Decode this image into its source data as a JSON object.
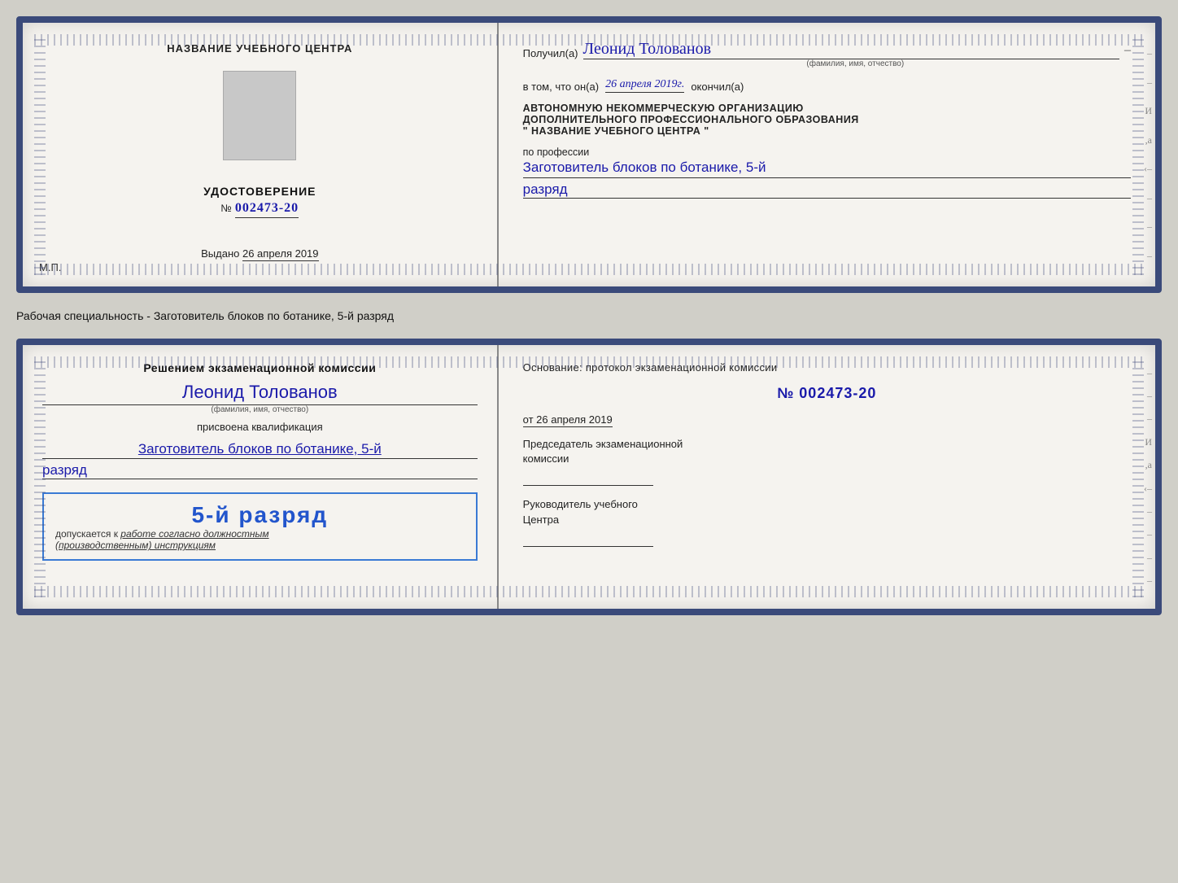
{
  "card1": {
    "left": {
      "title": "НАЗВАНИЕ УЧЕБНОГО ЦЕНТРА",
      "udostoverenie_label": "УДОСТОВЕРЕНИЕ",
      "number_prefix": "№",
      "number": "002473-20",
      "vydano_label": "Выдано",
      "vydano_date": "26 апреля 2019",
      "mp_label": "М.П."
    },
    "right": {
      "poluchil_label": "Получил(а)",
      "poluchil_name": "Леонид Толованов",
      "fio_sub": "(фамилия, имя, отчество)",
      "dash": "–",
      "vtom_label": "в том, что он(а)",
      "vtom_date": "26 апреля 2019г.",
      "okoncil_label": "окончил(а)",
      "org_line1": "АВТОНОМНУЮ НЕКОММЕРЧЕСКУЮ ОРГАНИЗАЦИЮ",
      "org_line2": "ДОПОЛНИТЕЛЬНОГО ПРОФЕССИОНАЛЬНОГО ОБРАЗОВАНИЯ",
      "org_name": "\" НАЗВАНИЕ УЧЕБНОГО ЦЕНТРА \"",
      "po_professii_label": "по профессии",
      "profession": "Заготовитель блоков по ботанике, 5-й",
      "razryad": "разряд"
    }
  },
  "subtitle": "Рабочая специальность - Заготовитель блоков по ботанике, 5-й разряд",
  "card2": {
    "left": {
      "resheniem_label": "Решением экзаменационной комиссии",
      "name": "Леонид Толованов",
      "fio_sub": "(фамилия, имя, отчество)",
      "prisvoena_label": "присвоена квалификация",
      "kvalif": "Заготовитель блоков по ботанике, 5-й",
      "razryad": "разряд",
      "stamp_grade": "5-й разряд",
      "dopuskaetsya_label": "допускается к",
      "dopusk_text": "работе согласно должностным",
      "dopusk_text2": "(производственным) инструкциям"
    },
    "right": {
      "osnov_label": "Основание: протокол экзаменационной комиссии",
      "number_prefix": "№",
      "number": "002473-20",
      "ot_label": "от",
      "ot_date": "26 апреля 2019",
      "predsedatel_label": "Председатель экзаменационной",
      "predsedatel_label2": "комиссии",
      "rukovod_label": "Руководитель учебного",
      "rukovod_label2": "Центра"
    }
  }
}
